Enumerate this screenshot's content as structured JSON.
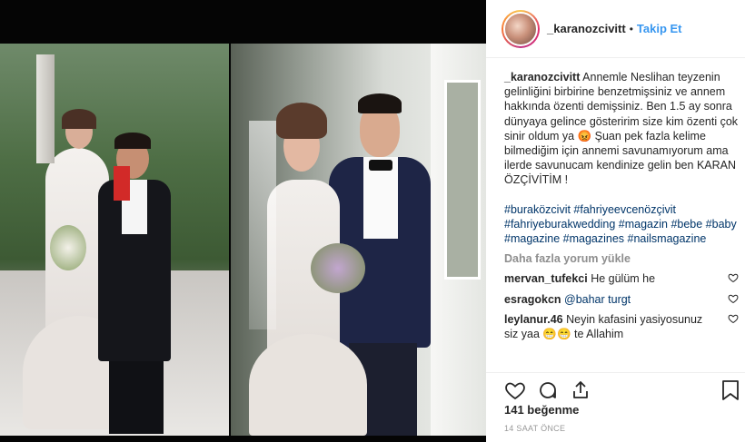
{
  "post": {
    "username": "_karanozcivitt",
    "follow_label": "Takip Et",
    "dot": "•",
    "caption_user": "_karanozcivitt",
    "caption_text": "Annemle Neslihan teyzenin gelinliğini birbirine benzetmişsiniz ve annem hakkında özenti demişsiniz. Ben 1.5 ay sonra dünyaya gelince gösteririm size kim özenti çok sinir oldum ya 😡 Şuan pek fazla kelime bilmediğim için annemi savunamıyorum ama ilerde savunucam kendinize gelin ben KARAN ÖZÇİVİTİM !",
    "hashtags": "#buraközcivit #fahriyeevcenözçivit #fahriyeburakwedding #magazin #bebe #baby #magazine #magazines #nailsmagazine",
    "load_more": "Daha fazla yorum yükle",
    "comments": [
      {
        "user": "mervan_tufekci",
        "text": "He gülüm he"
      },
      {
        "user": "esragokcn",
        "text": "@bahar turgt"
      },
      {
        "user": "leylanur.46",
        "text": "Neyin kafasini yasiyosunuz siz yaa 😁😁 te Allahim"
      }
    ],
    "likes": "141 beğenme",
    "time": "14 SAAT ÖNCE"
  },
  "icons": [
    "heart-icon",
    "comment-icon",
    "share-icon",
    "bookmark-icon"
  ],
  "colors": {
    "link": "#3897f0",
    "hashtag": "#003569",
    "muted": "#8e8e8e"
  }
}
